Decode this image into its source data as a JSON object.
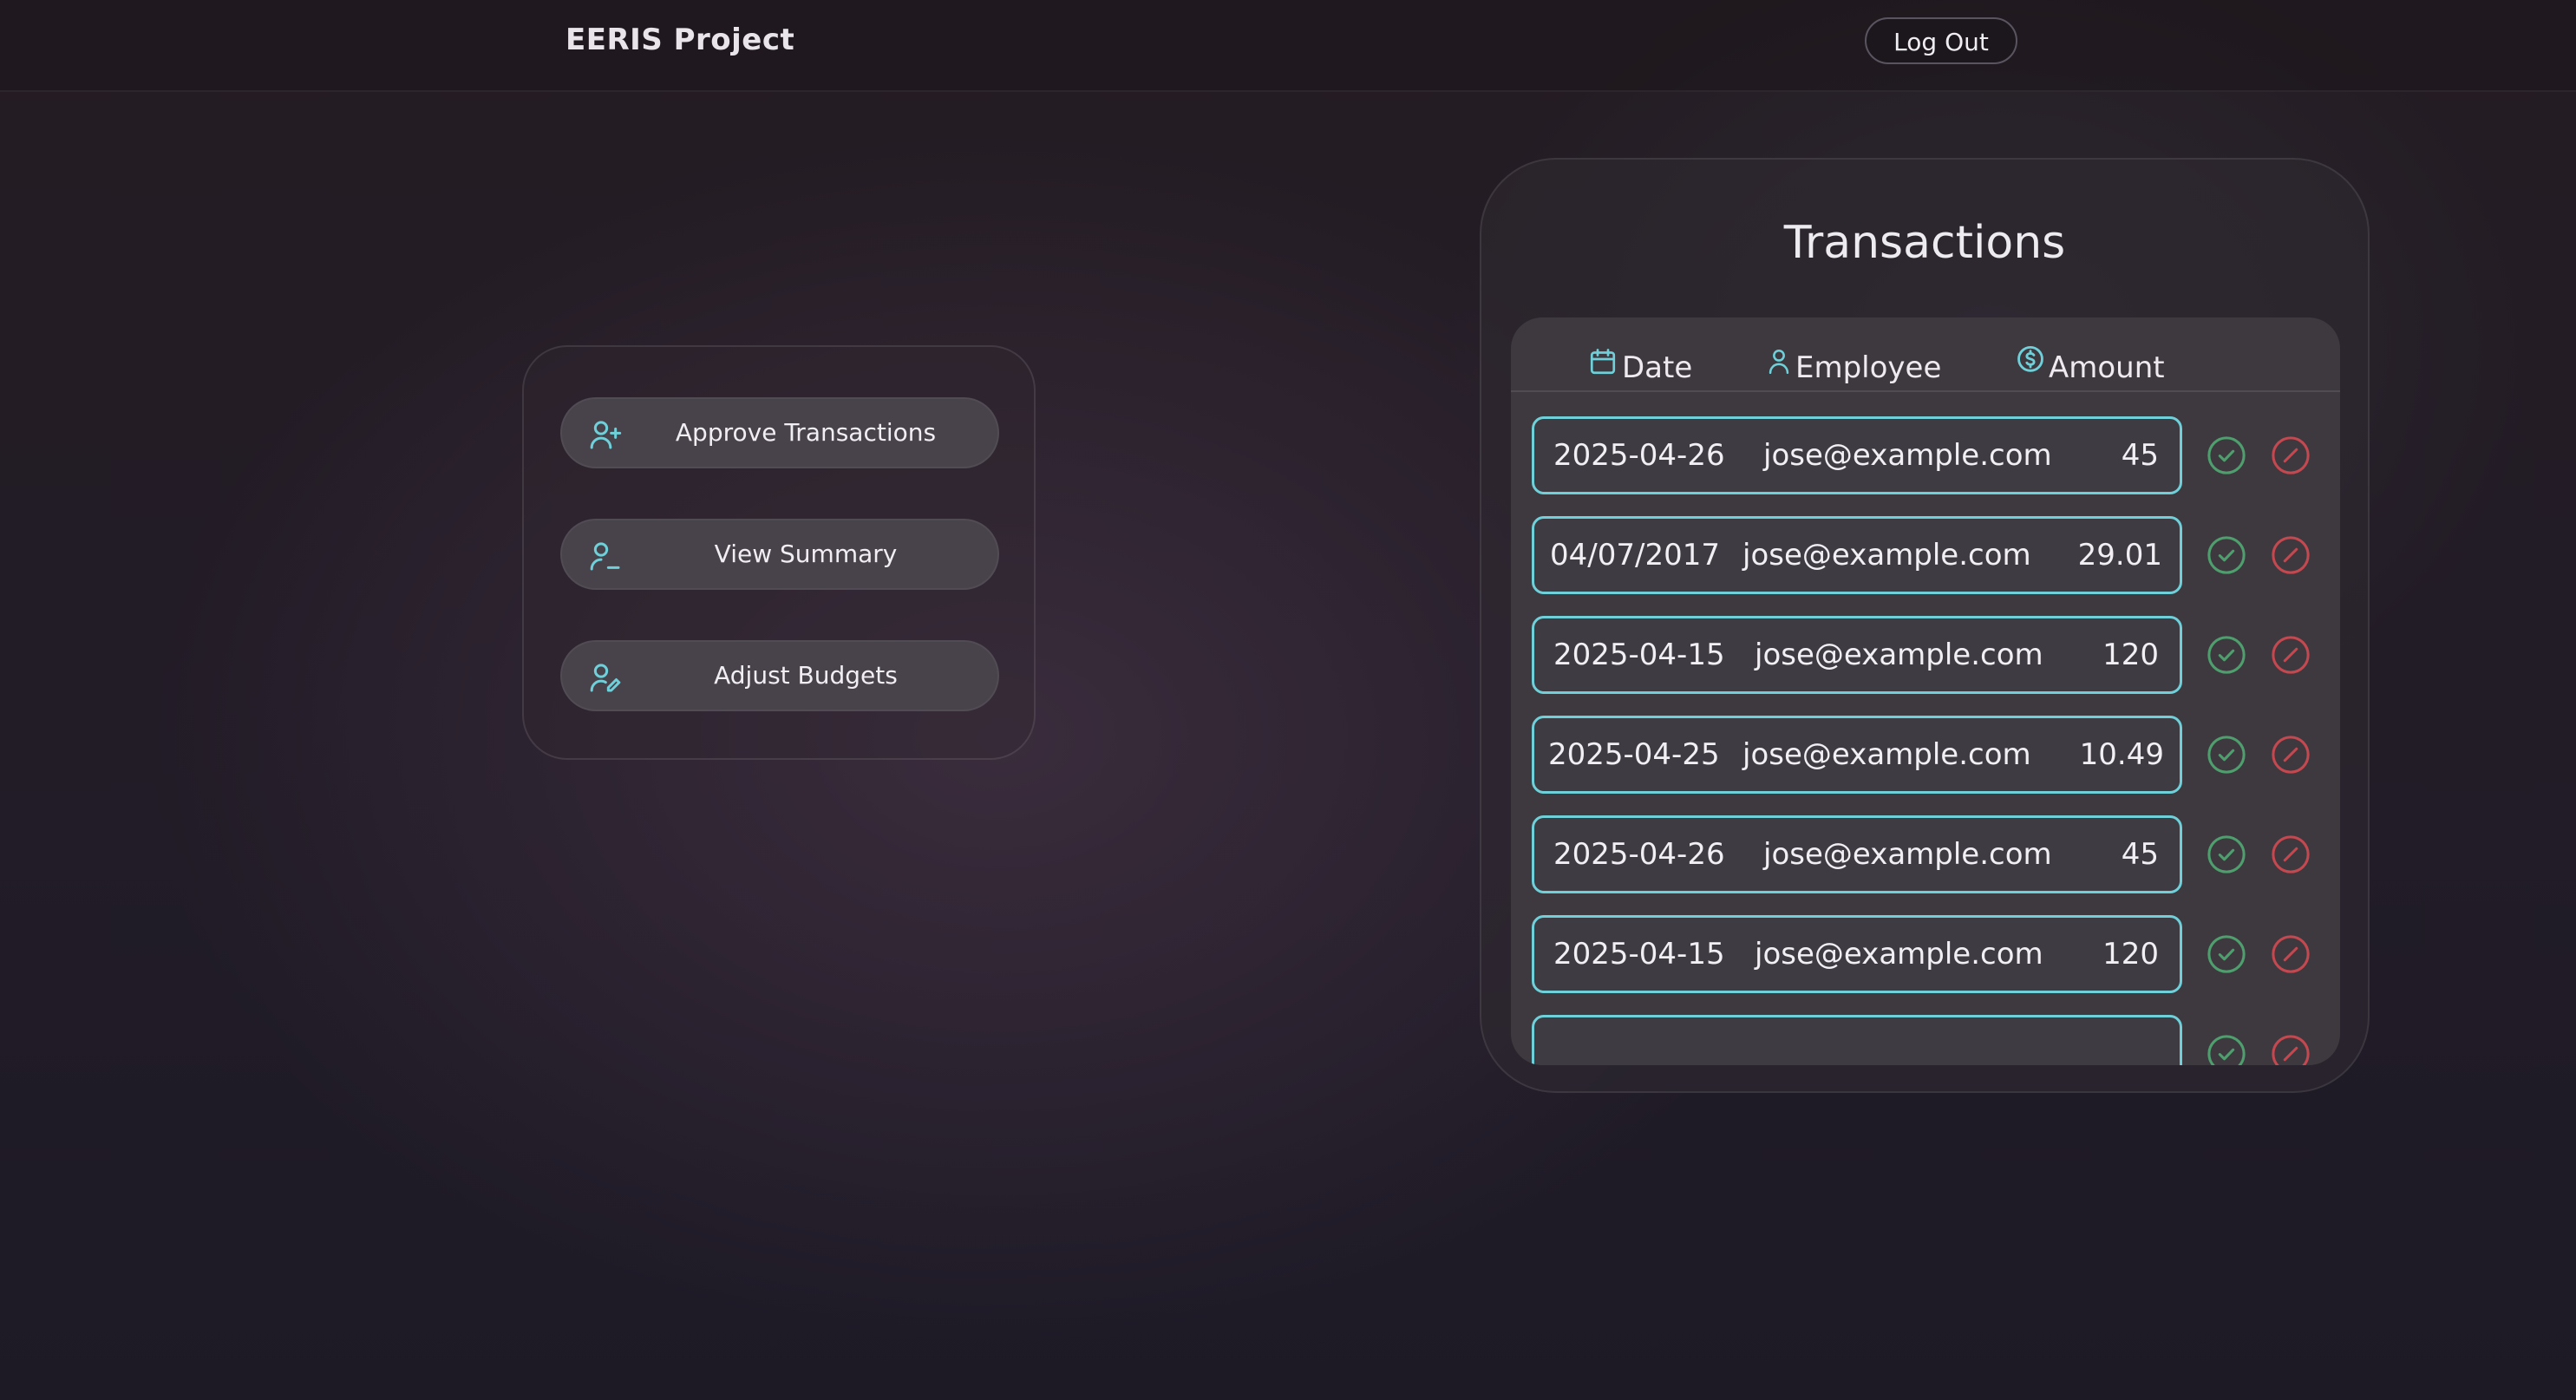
{
  "header": {
    "title": "EERIS Project",
    "logout_label": "Log Out"
  },
  "menu": {
    "items": [
      {
        "label": "Approve Transactions",
        "icon": "user-plus-icon"
      },
      {
        "label": "View Summary",
        "icon": "user-minus-icon"
      },
      {
        "label": "Adjust Budgets",
        "icon": "user-edit-icon"
      }
    ]
  },
  "transactions": {
    "title": "Transactions",
    "columns": {
      "date": "Date",
      "employee": "Employee",
      "amount": "Amount"
    },
    "rows": [
      {
        "date": "2025-04-26",
        "employee": "jose@example.com",
        "amount": "45"
      },
      {
        "date": "04/07/2017",
        "employee": "jose@example.com",
        "amount": "29.01"
      },
      {
        "date": "2025-04-15",
        "employee": "jose@example.com",
        "amount": "120"
      },
      {
        "date": "2025-04-25",
        "employee": "jose@example.com",
        "amount": "10.49"
      },
      {
        "date": "2025-04-26",
        "employee": "jose@example.com",
        "amount": "45"
      },
      {
        "date": "2025-04-15",
        "employee": "jose@example.com",
        "amount": "120"
      },
      {
        "date": "",
        "employee": "",
        "amount": ""
      }
    ]
  },
  "colors": {
    "accent": "#6fd0d9",
    "approve": "#4f9e6e",
    "reject": "#c4484f"
  }
}
